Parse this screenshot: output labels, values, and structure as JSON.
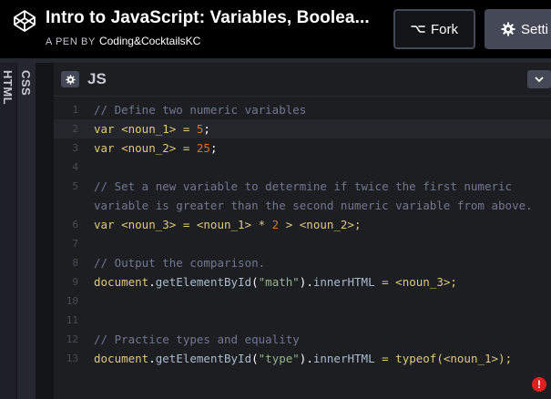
{
  "header": {
    "title": "Intro to JavaScript: Variables, Boolea...",
    "byline_prefix": "A PEN BY",
    "author": "Coding&CocktailsKC",
    "fork_label": "Fork",
    "settings_label": "Setti"
  },
  "panels": {
    "html_label": "HTML",
    "css_label": "CSS",
    "js_label": "JS"
  },
  "colors": {
    "accent_error": "#e0201f",
    "keyword": "#ddca7e",
    "number": "#d0782a",
    "string": "#96b38a",
    "comment": "#717790"
  },
  "icons": [
    "codepen-logo-icon",
    "fork-icon",
    "gear-icon",
    "chevron-down-icon",
    "error-icon"
  ],
  "code": {
    "lines": [
      {
        "num": "1",
        "tokens": [
          {
            "t": "// Define two numeric variables",
            "c": "comment"
          }
        ]
      },
      {
        "num": "2",
        "active": true,
        "tokens": [
          {
            "t": "var",
            "c": "keyword"
          },
          {
            "t": " <noun_1> = ",
            "c": "var"
          },
          {
            "t": "5",
            "c": "number"
          },
          {
            "t": ";",
            "c": "plain"
          }
        ]
      },
      {
        "num": "3",
        "tokens": [
          {
            "t": "var",
            "c": "keyword"
          },
          {
            "t": " <noun_2> = ",
            "c": "var"
          },
          {
            "t": "25",
            "c": "number"
          },
          {
            "t": ";",
            "c": "plain"
          }
        ]
      },
      {
        "num": "4",
        "tokens": []
      },
      {
        "num": "5",
        "tokens": [
          {
            "t": "// Set a new variable to determine if twice the first numeric",
            "c": "comment"
          }
        ]
      },
      {
        "num": "",
        "tokens": [
          {
            "t": "variable is greater than the second numeric variable from above.",
            "c": "comment"
          }
        ]
      },
      {
        "num": "6",
        "tokens": [
          {
            "t": "var",
            "c": "keyword"
          },
          {
            "t": " <noun_3> = <noun_1> * ",
            "c": "var"
          },
          {
            "t": "2",
            "c": "number"
          },
          {
            "t": " > <noun_2>;",
            "c": "var"
          }
        ]
      },
      {
        "num": "7",
        "tokens": []
      },
      {
        "num": "8",
        "tokens": [
          {
            "t": "// Output the comparison.",
            "c": "comment"
          }
        ]
      },
      {
        "num": "9",
        "tokens": [
          {
            "t": "document",
            "c": "var"
          },
          {
            "t": ".",
            "c": "plain"
          },
          {
            "t": "getElementById",
            "c": "func"
          },
          {
            "t": "(",
            "c": "plain"
          },
          {
            "t": "\"math\"",
            "c": "string"
          },
          {
            "t": ").",
            "c": "plain"
          },
          {
            "t": "innerHTML",
            "c": "func"
          },
          {
            "t": " = <noun_3>;",
            "c": "var"
          }
        ]
      },
      {
        "num": "10",
        "tokens": []
      },
      {
        "num": "11",
        "tokens": []
      },
      {
        "num": "12",
        "tokens": [
          {
            "t": "// Practice types and equality",
            "c": "comment"
          }
        ]
      },
      {
        "num": "13",
        "tokens": [
          {
            "t": "document",
            "c": "var"
          },
          {
            "t": ".",
            "c": "plain"
          },
          {
            "t": "getElementById",
            "c": "func"
          },
          {
            "t": "(",
            "c": "plain"
          },
          {
            "t": "\"type\"",
            "c": "string"
          },
          {
            "t": ").",
            "c": "plain"
          },
          {
            "t": "innerHTML",
            "c": "func"
          },
          {
            "t": " = ",
            "c": "var"
          },
          {
            "t": "typeof",
            "c": "keyword"
          },
          {
            "t": "(<noun_1>);",
            "c": "var"
          }
        ]
      }
    ]
  },
  "error_badge": "!"
}
